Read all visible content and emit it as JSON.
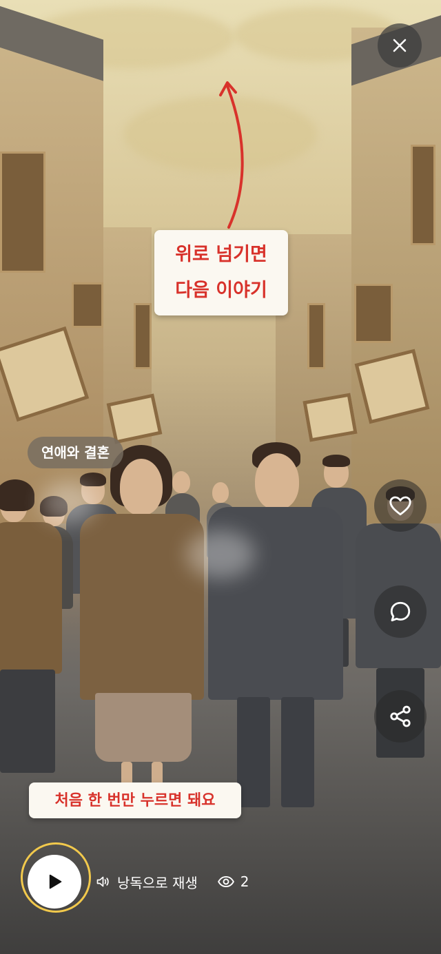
{
  "close_button": {
    "icon": "close-icon"
  },
  "gesture_hint": {
    "line1": "위로 넘기면",
    "line2": "다음 이야기",
    "color": "#d8322b"
  },
  "category_tag": {
    "label": "연애와 결혼"
  },
  "actions": {
    "like_icon": "heart-icon",
    "comment_icon": "comment-icon",
    "share_icon": "share-icon"
  },
  "tap_hint": {
    "text": "처음 한 번만 누르면 돼요"
  },
  "player": {
    "play_icon": "play-icon",
    "tts_icon": "speaker-icon",
    "tts_label": "낭독으로 재생",
    "views_icon": "eye-icon",
    "views_count": "2",
    "ring_color": "#f2c94c"
  }
}
